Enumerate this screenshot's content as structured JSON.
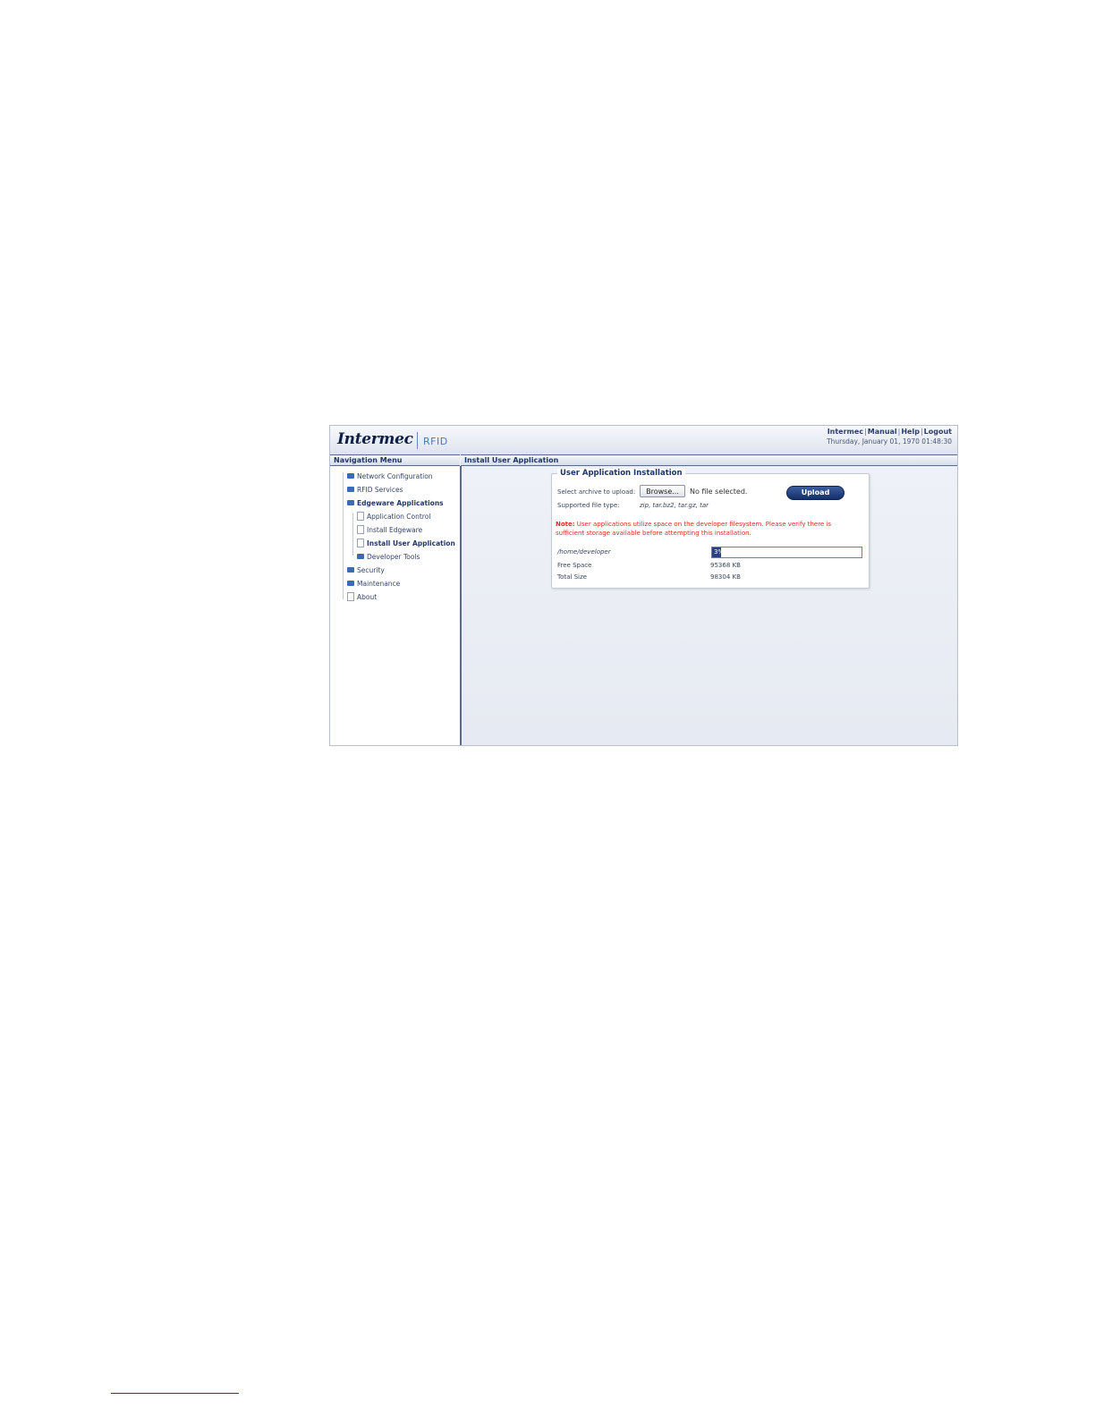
{
  "header": {
    "logo_text": "Intermec",
    "logo_suffix": "RFID",
    "links": [
      "Intermec",
      "Manual",
      "Help",
      "Logout"
    ],
    "datetime": "Thursday, January 01, 1970 01:48:30"
  },
  "nav": {
    "title": "Navigation Menu",
    "items": [
      {
        "label": "Network Configuration",
        "icon": "folder-icon"
      },
      {
        "label": "RFID Services",
        "icon": "folder-icon"
      },
      {
        "label": "Edgeware Applications",
        "icon": "folder-icon"
      },
      {
        "label": "Application Control",
        "icon": "document-icon"
      },
      {
        "label": "Install Edgeware",
        "icon": "document-icon"
      },
      {
        "label": "Install User Application",
        "icon": "document-icon"
      },
      {
        "label": "Developer Tools",
        "icon": "folder-icon"
      },
      {
        "label": "Security",
        "icon": "folder-icon"
      },
      {
        "label": "Maintenance",
        "icon": "folder-icon"
      },
      {
        "label": "About",
        "icon": "document-icon"
      }
    ]
  },
  "main": {
    "title": "Install User Application",
    "section_title": "User Application Installation",
    "select_label": "Select archive to upload:",
    "browse_label": "Browse...",
    "no_file_label": "No file selected.",
    "upload_label": "Upload",
    "file_type_label": "Supported file type:",
    "file_types": "zip, tar.bz2, tar.gz, tar",
    "note_label": "Note:",
    "note_text": " User applications utilize space on the developer filesystem. Please verify there is sufficient storage available before attempting this installation.",
    "path": "/home/developer",
    "usage_percent": 3,
    "usage_text": "3%",
    "free_space_label": "Free Space",
    "free_space_value": "95368 KB",
    "total_size_label": "Total Size",
    "total_size_value": "98304 KB"
  },
  "colors": {
    "header_navy": "#1f3564",
    "accent_blue": "#3b6bb3",
    "note_red": "#e02a2a",
    "progress_fill": "#2b3f80"
  }
}
